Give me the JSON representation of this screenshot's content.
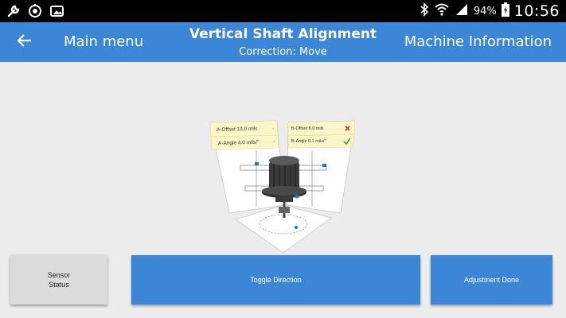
{
  "status_bar": {
    "battery_percent": "94%",
    "time": "10:56",
    "icons_left": [
      "wrench-icon",
      "sync-icon",
      "image-icon"
    ],
    "icons_right": [
      "bluetooth-icon",
      "wifi-icon",
      "signal-icon",
      "battery-icon"
    ]
  },
  "app_bar": {
    "back_icon": "arrow-left-icon",
    "main_menu_label": "Main menu",
    "title": "Vertical Shaft Alignment",
    "subtitle": "Correction: Move",
    "machine_info_label": "Machine Information",
    "color": "#3b86d6"
  },
  "diagram": {
    "left_panel": {
      "offset_label": "A-Offset 13.0 mils",
      "angle_label": "A-Angle 4.0 mils/\""
    },
    "right_panel": {
      "offset_label": "B-Offset 8.0 mils",
      "angle_label": "B-Angle 0.1 mils/\"",
      "offset_status": "cross-icon",
      "angle_status": "check-icon"
    }
  },
  "buttons": {
    "sensor_status_line1": "Sensor",
    "sensor_status_line2": "Status",
    "toggle_direction": "Toggle Direction",
    "adjustment_done": "Adjustment Done"
  }
}
